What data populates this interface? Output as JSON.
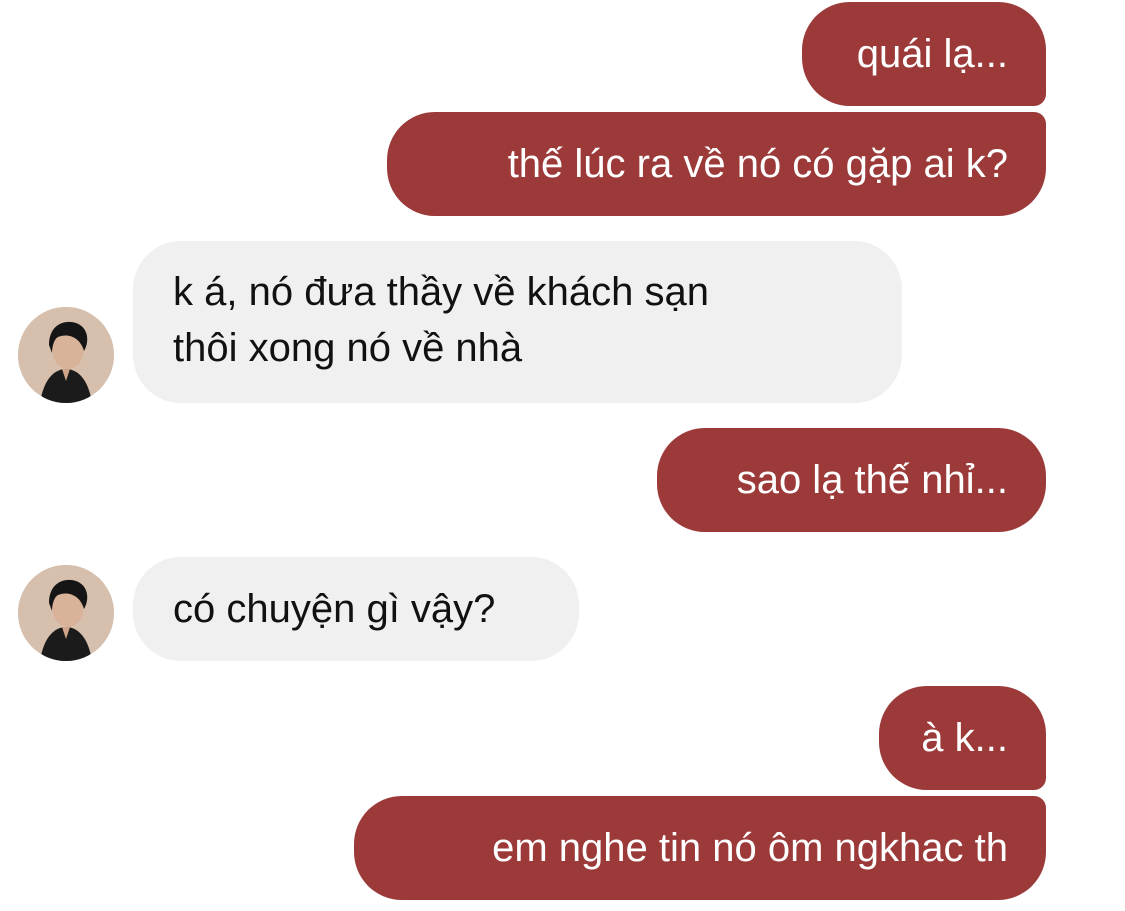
{
  "colors": {
    "outgoing_bubble": "#9c3a3a",
    "outgoing_text": "#ffffff",
    "incoming_bubble": "#f0f0f0",
    "incoming_text": "#111111",
    "background": "#ffffff"
  },
  "messages": [
    {
      "side": "outgoing",
      "text": "quái lạ..."
    },
    {
      "side": "outgoing",
      "text": "thế lúc ra về nó có gặp ai k?"
    },
    {
      "side": "incoming",
      "avatar_icon": "contact-avatar-icon",
      "lines": [
        "k á, nó đưa thầy về khách sạn",
        "thôi xong nó về nhà"
      ]
    },
    {
      "side": "outgoing",
      "text": "sao lạ thế nhỉ..."
    },
    {
      "side": "incoming",
      "avatar_icon": "contact-avatar-icon",
      "lines": [
        "có chuyện gì vậy?"
      ]
    },
    {
      "side": "outgoing",
      "text": "à k..."
    },
    {
      "side": "outgoing",
      "text": "em nghe tin nó ôm ngkhac th"
    }
  ]
}
